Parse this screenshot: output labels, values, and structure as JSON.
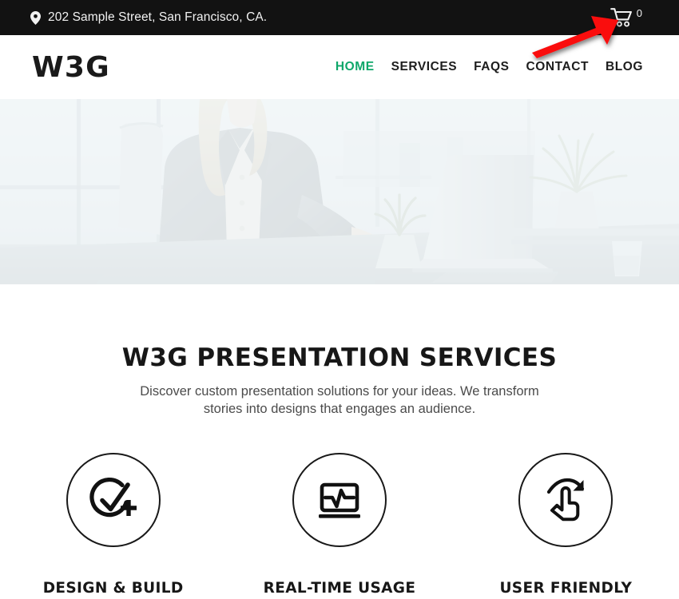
{
  "topbar": {
    "address": "202 Sample Street, San Francisco, CA.",
    "pin_icon": "map-pin-icon",
    "cart_icon": "shopping-cart-icon",
    "cart_count": "0",
    "background_color": "#121212",
    "text_color": "#f2f2f2"
  },
  "header": {
    "logo": "W3G",
    "background_color": "#ffffff",
    "nav": [
      {
        "label": "HOME",
        "active": true
      },
      {
        "label": "SERVICES",
        "active": false
      },
      {
        "label": "FAQS",
        "active": false
      },
      {
        "label": "CONTACT",
        "active": false
      },
      {
        "label": "BLOG",
        "active": false
      }
    ],
    "active_color": "#0fa76a",
    "inactive_color": "#1d1d1d"
  },
  "hero": {
    "alt": "Businesswoman working on a laptop at an office desk with a potted plant and windows",
    "treatment": "washed-out light overlay"
  },
  "main": {
    "title": "W3G PRESENTATION SERVICES",
    "subtitle": "Discover custom presentation solutions for your ideas. We transform stories into designs that engages an audience.",
    "features": [
      {
        "icon": "check-circle-plus-icon",
        "title": "DESIGN & BUILD"
      },
      {
        "icon": "laptop-analytics-icon",
        "title": "REAL-TIME USAGE"
      },
      {
        "icon": "hand-pointer-rotate-icon",
        "title": "USER FRIENDLY"
      }
    ]
  },
  "annotation": {
    "arrow": "red-arrow-pointing-to-cart",
    "color": "#fa0a0a"
  }
}
